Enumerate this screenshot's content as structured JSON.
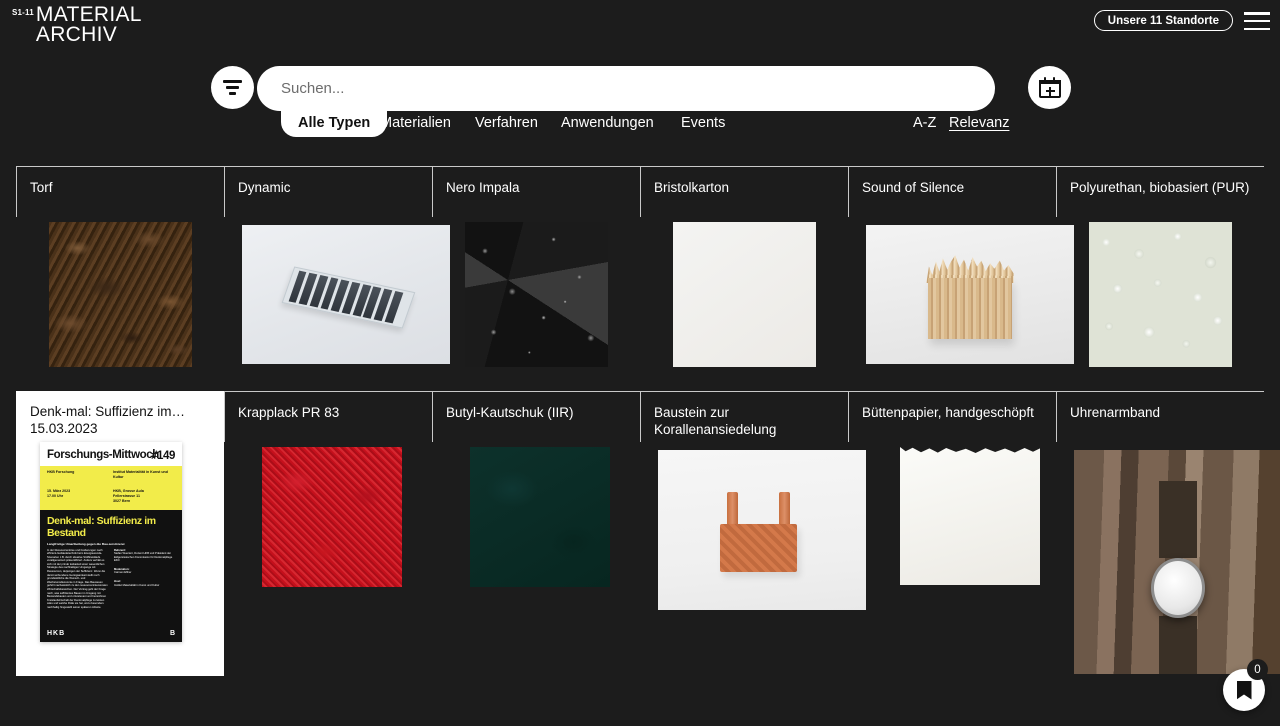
{
  "header": {
    "logo_sup": "S1-11",
    "logo_line1": "MATERIAL",
    "logo_line2": "ARCHIV",
    "locations_button": "Unsere 11 Standorte",
    "menu_icon": "hamburger-menu-icon"
  },
  "search": {
    "placeholder": "Suchen...",
    "value": "",
    "filter_icon": "filter-icon",
    "calendar_icon": "calendar-add-icon"
  },
  "tabs": [
    {
      "label": "Alle Typen",
      "active": true
    },
    {
      "label": "Materialien",
      "active": false
    },
    {
      "label": "Verfahren",
      "active": false
    },
    {
      "label": "Anwendungen",
      "active": false
    },
    {
      "label": "Events",
      "active": false
    }
  ],
  "sort": [
    {
      "label": "A-Z",
      "active": false
    },
    {
      "label": "Relevanz",
      "active": true
    }
  ],
  "results": {
    "row1": [
      {
        "title": "Torf",
        "thumb": "peat-soil-texture"
      },
      {
        "title": "Dynamic",
        "thumb": "solar-panel-module"
      },
      {
        "title": "Nero Impala",
        "thumb": "black-granite-texture"
      },
      {
        "title": "Bristolkarton",
        "thumb": "white-cardboard-sheet"
      },
      {
        "title": "Sound of Silence",
        "thumb": "wood-fiber-acoustic-block"
      },
      {
        "title": "Polyurethan, biobasiert (PUR)",
        "thumb": "pur-granulate-pellets"
      }
    ],
    "row2": [
      {
        "title": "Denk-mal: Suffizienz im…",
        "date": "15.03.2023",
        "type": "event",
        "thumb": "event-poster"
      },
      {
        "title": "Krapplack PR 83",
        "thumb": "red-pigment-powder"
      },
      {
        "title": "Butyl-Kautschuk (IIR)",
        "thumb": "dark-green-rubber"
      },
      {
        "title": "Baustein zur Korallenansiedelung",
        "thumb": "terracotta-coral-block"
      },
      {
        "title": "Büttenpapier, handgeschöpft",
        "thumb": "handmade-deckle-paper"
      },
      {
        "title": "Uhrenarmband",
        "thumb": "wristwatch-on-wood"
      }
    ]
  },
  "poster": {
    "heading": "Forschungs-Mittwoch",
    "number": "#149",
    "meta_left_1": "HKB Forschung",
    "meta_right_1": "Institut Materialität in Kunst und Kultur",
    "meta_left_2": "15. März 2023\n17.00 Uhr",
    "meta_right_2": "HKB, Grosse Aula\nFellerstrasse 11\n3027 Bern",
    "title": "Denk-mal: Suffizienz im Bestand",
    "subtitle": "Langfristige Umartbeitung gegen die Bau-zerstörerei",
    "body": "In der Ressourcenkrise und Forderungen nach effizient-Gebäudetechnik beim Energiewende-Szenarien z.B. durch situative Stoffkreisläufe verallgemeinert präsentifiziert. Anders verhält es sich mit der primär lesbarkeit einer wesentlichen Strategie des nachhaltigen Umgangs mit Ressourcen, derjenigen der Suffizienz. Wenn die damit verbundene Genügsamkeit stellt noch grundsätzliche die Wunsch- und Wachstumsökonomie in Frage. Das Bauwesen gehört nachweislich zu den ressourcenintensivsten Wirtschaftsbereichen. Der Vortrag geht der Frage nach, was suffizientes Bauen im Umgang mit Bestandsbauten und ortsrelevant und bezeichnen Kreislaufwirtschaft der Denkmalpflege zu leisten wäre und welche Rolle sie hat, wozu besonders nachhaltig hingestellt seiner späteren Arbeite.",
    "credit1_label": "Referent:",
    "credit1_value": "Stefan Wuertert, Dozent HKB und Präsident der Eidgenössischen Kommission für Denkmalpflege EKD",
    "credit2_label": "Moderation:",
    "credit2_value": "Carmen Effner",
    "credit3_label": "Host:",
    "credit3_value": "Institut Materialität in Kunst und Kultur",
    "footer_left": "HKB",
    "footer_right": "B"
  },
  "bookmark": {
    "icon": "bookmark-icon",
    "count": "0"
  },
  "colors": {
    "background": "#1c1c1c",
    "accent": "#ffffff",
    "poster_yellow": "#f2ec4a",
    "divider": "#c9c9c9"
  }
}
